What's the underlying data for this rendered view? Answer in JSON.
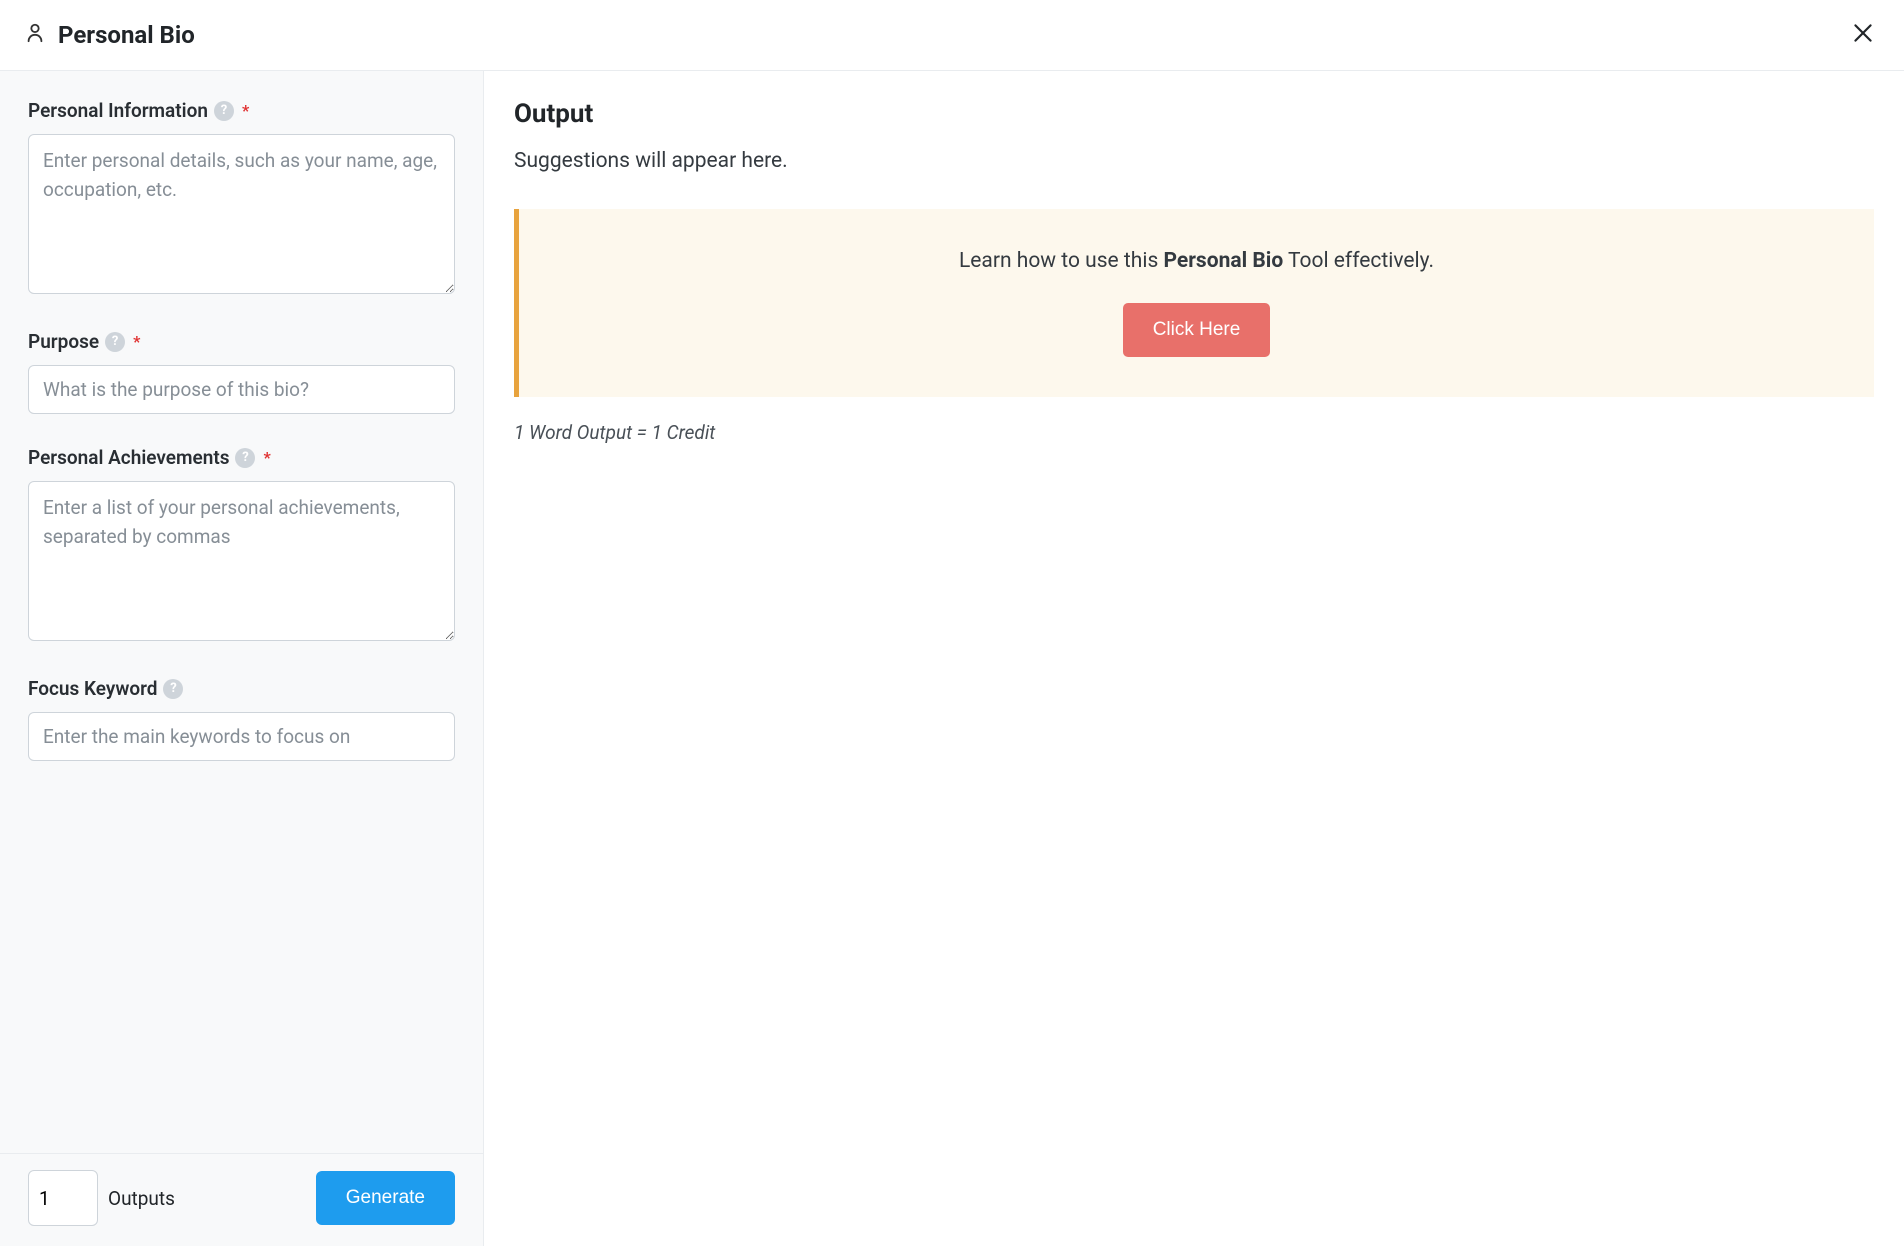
{
  "header": {
    "title": "Personal Bio"
  },
  "form": {
    "personal_info": {
      "label": "Personal Information",
      "placeholder": "Enter personal details, such as your name, age, occupation, etc.",
      "required": true
    },
    "purpose": {
      "label": "Purpose",
      "placeholder": "What is the purpose of this bio?",
      "required": true
    },
    "achievements": {
      "label": "Personal Achievements",
      "placeholder": "Enter a list of your personal achievements, separated by commas",
      "required": true
    },
    "focus_keyword": {
      "label": "Focus Keyword",
      "placeholder": "Enter the main keywords to focus on",
      "required": false
    }
  },
  "footer": {
    "outputs_value": "1",
    "outputs_label": "Outputs",
    "generate_label": "Generate"
  },
  "output": {
    "title": "Output",
    "placeholder_text": "Suggestions will appear here.",
    "tip_prefix": "Learn how to use this ",
    "tip_bold": "Personal Bio",
    "tip_suffix": " Tool effectively.",
    "tip_button": "Click Here",
    "credit_note": "1 Word Output = 1 Credit"
  }
}
